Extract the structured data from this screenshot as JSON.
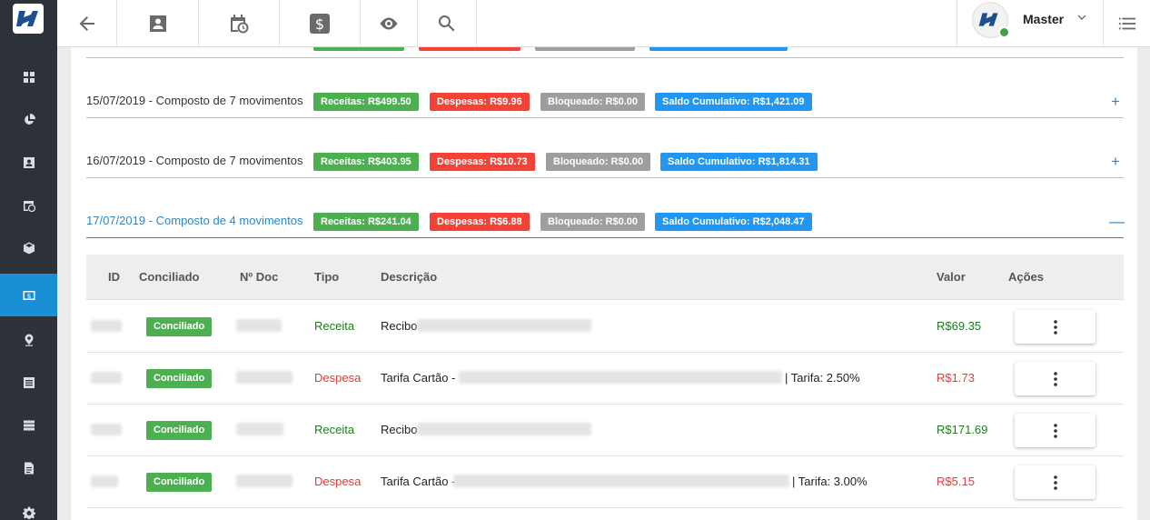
{
  "sidebar": {
    "items": [
      {
        "icon": "dashboard-icon",
        "active": false
      },
      {
        "icon": "pie-chart-icon",
        "active": false
      },
      {
        "icon": "contact-card-icon",
        "active": false
      },
      {
        "icon": "calendar-clock-icon",
        "active": false
      },
      {
        "icon": "box-icon",
        "active": false
      },
      {
        "icon": "money-icon",
        "active": true
      },
      {
        "icon": "map-pin-icon",
        "active": false
      },
      {
        "icon": "list-icon",
        "active": false
      },
      {
        "icon": "server-icon",
        "active": false
      },
      {
        "icon": "document-icon",
        "active": false
      },
      {
        "icon": "gear-icon",
        "active": false
      }
    ]
  },
  "topbar": {
    "buttons": [
      "back-arrow-icon",
      "contact-card-icon",
      "calendar-clock-icon",
      "dollar-icon",
      "eye-icon",
      "search-icon"
    ],
    "user_name": "Master"
  },
  "groups": [
    {
      "title": "15/07/2019 - Composto de 7 movimentos",
      "receitas": "Receitas: R$499.50",
      "despesas": "Despesas: R$9.96",
      "bloqueado": "Bloqueado: R$0.00",
      "saldo": "Saldo Cumulativo: R$1,421.09",
      "toggle": "+"
    },
    {
      "title": "16/07/2019 - Composto de 7 movimentos",
      "receitas": "Receitas: R$403.95",
      "despesas": "Despesas: R$10.73",
      "bloqueado": "Bloqueado: R$0.00",
      "saldo": "Saldo Cumulativo: R$1,814.31",
      "toggle": "+"
    },
    {
      "title": "17/07/2019 - Composto de 4 movimentos",
      "receitas": "Receitas: R$241.04",
      "despesas": "Despesas: R$6.88",
      "bloqueado": "Bloqueado: R$0.00",
      "saldo": "Saldo Cumulativo: R$2,048.47",
      "toggle": "—"
    }
  ],
  "table": {
    "headers": {
      "id": "ID",
      "conciliado": "Conciliado",
      "ndoc": "Nº Doc",
      "tipo": "Tipo",
      "descricao": "Descrição",
      "valor": "Valor",
      "acoes": "Ações"
    },
    "rows": [
      {
        "status": "Conciliado",
        "tipo": "Receita",
        "descricao": "Recibo",
        "tarifa": "",
        "valor": "R$69.35"
      },
      {
        "status": "Conciliado",
        "tipo": "Despesa",
        "descricao": "Tarifa Cartão -",
        "tarifa": "| Tarifa: 2.50%",
        "valor": "R$1.73"
      },
      {
        "status": "Conciliado",
        "tipo": "Receita",
        "descricao": "Recibo",
        "tarifa": "",
        "valor": "R$171.69"
      },
      {
        "status": "Conciliado",
        "tipo": "Despesa",
        "descricao": "Tarifa Cartão -",
        "tarifa": "| Tarifa: 3.00%",
        "valor": "R$5.15"
      }
    ]
  },
  "colors": {
    "accent": "#1a8fd6",
    "green": "#4caf50",
    "red": "#f44336",
    "grey": "#9e9e9e",
    "blue": "#2196f3"
  }
}
